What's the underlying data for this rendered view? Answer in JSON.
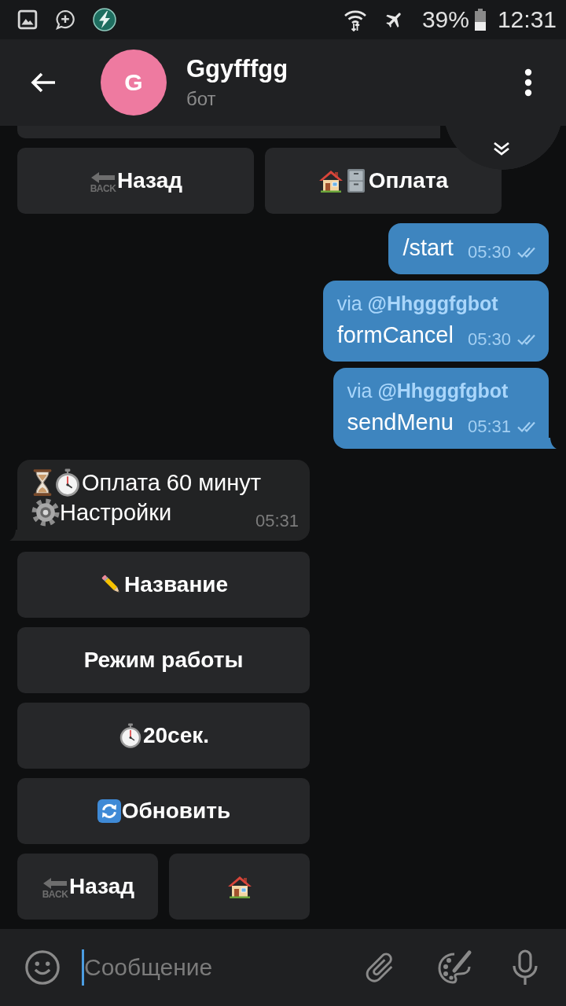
{
  "status_bar": {
    "battery": "39%",
    "time": "12:31"
  },
  "header": {
    "avatar_letter": "G",
    "title": "Ggyfffgg",
    "subtitle": "бот"
  },
  "chat": {
    "top_keyboard": [
      [
        {
          "label": "Назад",
          "icons": [
            {
              "kind": "back",
              "caption": "BACK"
            }
          ]
        },
        {
          "label": "Оплата",
          "icons": [
            {
              "kind": "house"
            },
            {
              "kind": "cabinet"
            }
          ]
        }
      ]
    ],
    "messages": [
      {
        "kind": "outgoing",
        "text": "/start",
        "time": "05:30",
        "read": true,
        "tail": false
      },
      {
        "kind": "outgoing",
        "via": "via **@Hhgggfgbot**",
        "text": "formCancel",
        "time": "05:30",
        "read": true,
        "tail": false
      },
      {
        "kind": "outgoing",
        "via": "via **@Hhgggfgbot**",
        "text": "sendMenu",
        "time": "05:31",
        "read": true,
        "tail": true
      },
      {
        "kind": "incoming",
        "lines": [
          {
            "icons": [
              {
                "kind": "hourglass"
              },
              {
                "kind": "stopwatch"
              }
            ],
            "text": "Оплата 60 минут"
          },
          {
            "icons": [
              {
                "kind": "gear"
              }
            ],
            "text": "Настройки"
          }
        ],
        "time": "05:31",
        "tail": true,
        "keyboard": [
          [
            {
              "label": "Название",
              "icons": [
                {
                  "kind": "pencil"
                }
              ]
            }
          ],
          [
            {
              "label": "Режим работы"
            }
          ],
          [
            {
              "label": "20сек.",
              "icons": [
                {
                  "kind": "stopwatch"
                }
              ]
            }
          ],
          [
            {
              "label": "Обновить",
              "icons": [
                {
                  "kind": "refresh"
                }
              ]
            }
          ],
          [
            {
              "label": "Назад",
              "icons": [
                {
                  "kind": "back",
                  "caption": "BACK"
                }
              ]
            },
            {
              "icons": [
                {
                  "kind": "house"
                }
              ]
            }
          ]
        ]
      }
    ]
  },
  "composer": {
    "placeholder": "Сообщение"
  }
}
